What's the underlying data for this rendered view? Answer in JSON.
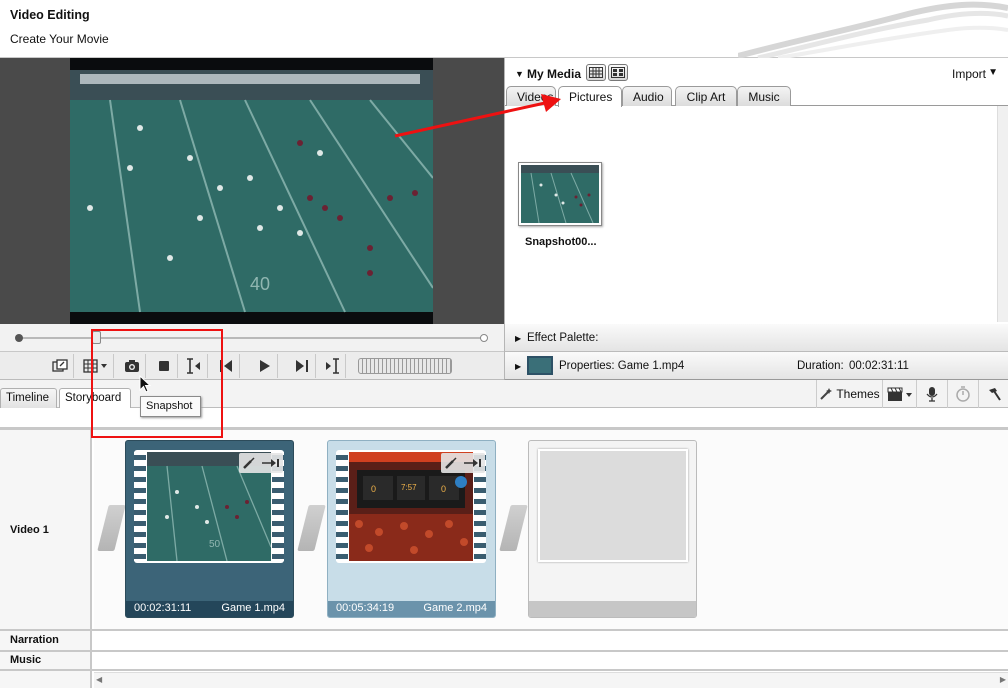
{
  "header": {
    "title": "Video Editing",
    "subtitle": "Create Your Movie"
  },
  "preview": {
    "footage": "football-game-frame"
  },
  "transport": {
    "buttons": [
      "fullscreen-icon",
      "aspect-grid-icon",
      "camera-icon",
      "stop-icon",
      "trim-start-icon",
      "step-back-icon",
      "play-icon",
      "step-forward-icon",
      "trim-end-icon"
    ]
  },
  "media": {
    "title": "My Media",
    "import_label": "Import",
    "tabs": [
      "Videos",
      "Pictures",
      "Audio",
      "Clip Art",
      "Music"
    ],
    "active_tab": "Pictures",
    "items": [
      {
        "name": "Snapshot00..."
      }
    ]
  },
  "effect_palette": {
    "label": "Effect Palette:"
  },
  "properties": {
    "label": "Properties: Game 1.mp4",
    "duration_label": "Duration:",
    "duration_value": "00:02:31:11"
  },
  "storyboard": {
    "tabs": [
      "Timeline",
      "Storyboard"
    ],
    "active_tab": "Storyboard",
    "themes_label": "Themes",
    "tooltip": "Snapshot",
    "rows": {
      "video": "Video 1",
      "narration": "Narration",
      "music": "Music"
    },
    "clips": [
      {
        "time": "00:02:31:11",
        "name": "Game 1.mp4",
        "selected": true
      },
      {
        "time": "00:05:34:19",
        "name": "Game 2.mp4",
        "selected": false
      }
    ]
  },
  "colors": {
    "selected_clip": "#3c6478",
    "highlight": "#e11111",
    "accent": "#24465a"
  }
}
